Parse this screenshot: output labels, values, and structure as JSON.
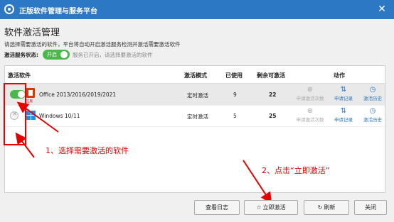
{
  "window": {
    "title": "正版软件管理与服务平台",
    "close_glyph": "✕"
  },
  "page": {
    "heading": "软件激活管理",
    "description": "请选择需要激活的软件，平台将自动开启激活服务检测并激活需要激活软件",
    "service_label": "激活服务状态:",
    "service_toggle": "开启",
    "service_status": "服务已开启，请选择要激活的软件"
  },
  "table": {
    "headers": {
      "software": "激活软件",
      "mode": "激活模式",
      "used": "已使用",
      "remaining": "剩余可激活",
      "actions": "动作"
    },
    "rows": [
      {
        "enabled": true,
        "name": "Office 2013/2016/2019/2021",
        "tag": "正版",
        "mode": "定时激活",
        "used": "9",
        "remaining": "22",
        "actions": [
          "申请激活次数",
          "申请记录",
          "激活历史"
        ]
      },
      {
        "enabled": false,
        "name": "Windows 10/11",
        "tag": "",
        "mode": "定时激活",
        "used": "5",
        "remaining": "25",
        "actions": [
          "申请激活次数",
          "申请记录",
          "激活历史"
        ]
      }
    ]
  },
  "annotations": {
    "step1": "1、选择需要激活的软件",
    "step2": "2、点击“立即激活”"
  },
  "buttons": {
    "log": "查看日志",
    "activate": "立即激活",
    "refresh": "刷新",
    "close": "关闭"
  },
  "icons": {
    "action1": "plus-circle-icon",
    "action2": "transfer-arrows-icon",
    "action3": "history-icon"
  },
  "colors": {
    "titlebar": "#2d78c4",
    "toggle_on": "#4cb84c",
    "annotation": "#e60000"
  }
}
